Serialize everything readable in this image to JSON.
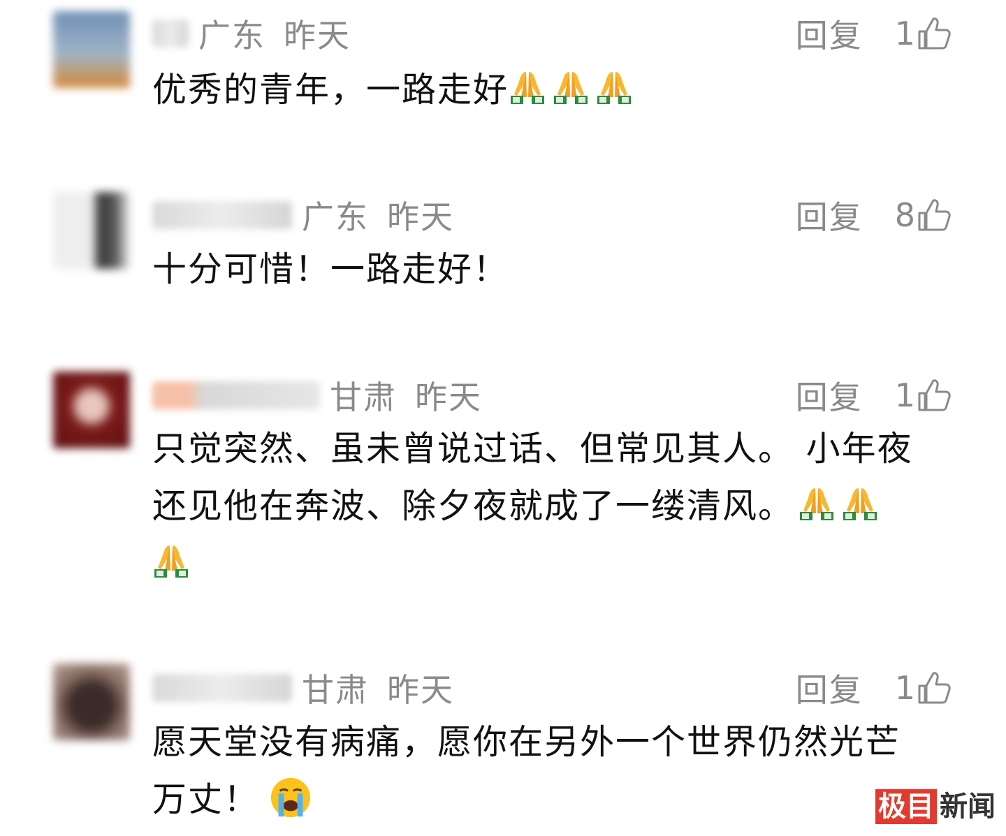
{
  "comments": [
    {
      "region": "广东",
      "time": "昨天",
      "reply_label": "回复",
      "likes": "1",
      "text": "优秀的青年，一路走好",
      "emojis": [
        "folded-hands",
        "folded-hands",
        "folded-hands"
      ],
      "avatar_colors": [
        "#6f8fb6",
        "#d58a3a"
      ]
    },
    {
      "region": "广东",
      "time": "昨天",
      "reply_label": "回复",
      "likes": "8",
      "text": "十分可惜！一路走好！",
      "emojis": [],
      "avatar_colors": [
        "#e6e6e6",
        "#3a3a3a"
      ]
    },
    {
      "region": "甘肃",
      "time": "昨天",
      "reply_label": "回复",
      "likes": "1",
      "text_line1": "只觉突然、虽未曾说过话、但常见其人。 小年夜",
      "text_line2": "还见他在奔波、除夕夜就成了一缕清风。",
      "emojis": [
        "folded-hands",
        "folded-hands",
        "folded-hands"
      ],
      "avatar_colors": [
        "#7a1a1a",
        "#d9b3a8"
      ]
    },
    {
      "region": "甘肃",
      "time": "昨天",
      "reply_label": "回复",
      "likes": "1",
      "text_line1": "愿天堂没有病痛，愿你在另外一个世界仍然光芒",
      "text_line2": "万丈！",
      "emojis": [
        "loudly-crying-face"
      ],
      "avatar_colors": [
        "#8a6f66",
        "#3b2a28"
      ]
    }
  ],
  "watermark": {
    "box_text": "极目",
    "text": "新闻",
    "color": "#e23a2e"
  }
}
